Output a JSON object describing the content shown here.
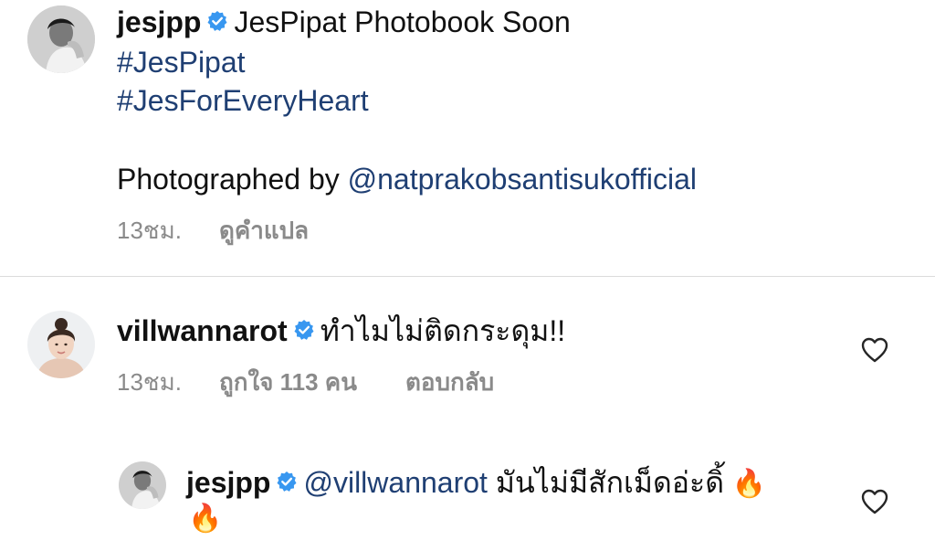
{
  "post": {
    "username": "jesjpp",
    "caption": "JesPipat Photobook Soon",
    "hashtags": [
      "#JesPipat",
      "#JesForEveryHeart"
    ],
    "credit_prefix": "Photographed by ",
    "credit_handle": "@natprakobsantisukofficial",
    "time": "13ชม.",
    "translate": "ดูคำแปล"
  },
  "comment": {
    "username": "villwannarot",
    "text": "ทำไมไม่ติดกระดุม!!",
    "time": "13ชม.",
    "likes": "ถูกใจ 113 คน",
    "reply": "ตอบกลับ"
  },
  "reply": {
    "username": "jesjpp",
    "mention": "@villwannarot",
    "text": " มันไม่มีสักเม็ดอ่ะดิ้ ",
    "emoji": "🔥",
    "emoji2": "🔥"
  },
  "icons": {
    "verified": "verified-badge-icon",
    "heart": "heart-outline-icon",
    "fire": "fire-emoji-icon"
  },
  "colors": {
    "link": "#1f3f73",
    "verified": "#3897f0",
    "meta": "#8a8a8a",
    "divider": "#dbdbdb"
  }
}
